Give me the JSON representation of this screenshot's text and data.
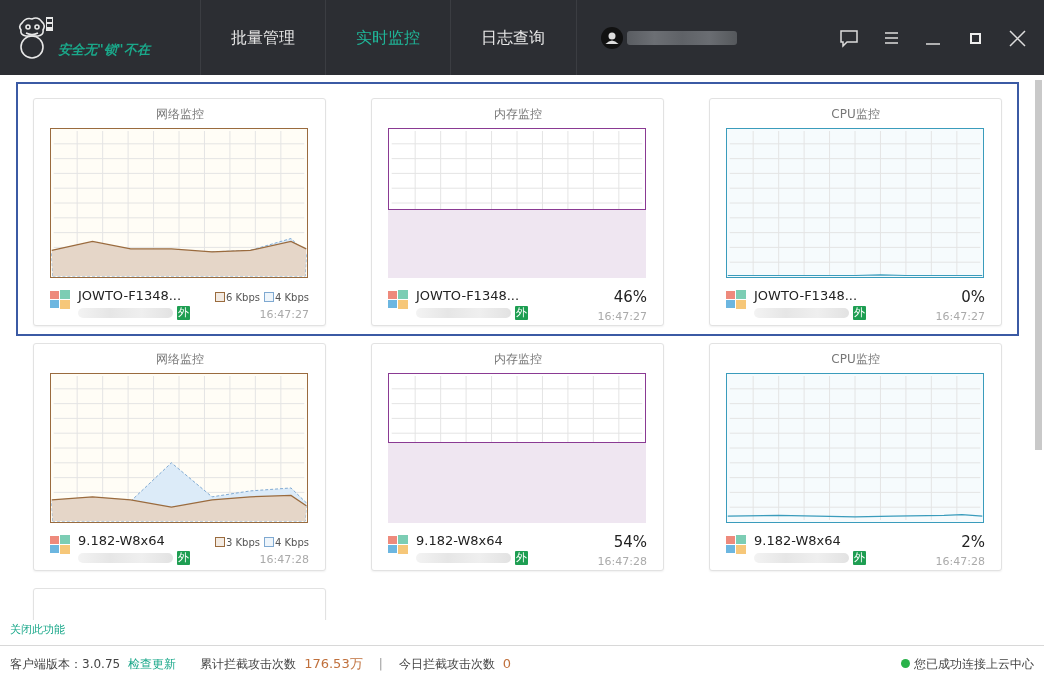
{
  "app": {
    "logo_text": "安全无\"锁\"不在"
  },
  "nav": [
    {
      "label": "批量管理",
      "selected": false
    },
    {
      "label": "实时监控",
      "selected": true
    },
    {
      "label": "日志查询",
      "selected": false
    }
  ],
  "rows": [
    {
      "selected": true,
      "monitors": [
        {
          "kind": "network",
          "title": "网络监控",
          "host": "JOWTO-F1348...",
          "legend": [
            "6 Kbps",
            "4 Kbps"
          ],
          "badge": "外",
          "time": "16:47:27"
        },
        {
          "kind": "memory",
          "title": "内存监控",
          "host": "JOWTO-F1348...",
          "reading": "46%",
          "badge": "外",
          "time": "16:47:27"
        },
        {
          "kind": "cpu",
          "title": "CPU监控",
          "host": "JOWTO-F1348...",
          "reading": "0%",
          "badge": "外",
          "time": "16:47:27"
        }
      ]
    },
    {
      "selected": false,
      "monitors": [
        {
          "kind": "network",
          "title": "网络监控",
          "host": "9.182-W8x64",
          "legend": [
            "3 Kbps",
            "4 Kbps"
          ],
          "badge": "外",
          "time": "16:47:28"
        },
        {
          "kind": "memory",
          "title": "内存监控",
          "host": "9.182-W8x64",
          "reading": "54%",
          "badge": "外",
          "time": "16:47:28"
        },
        {
          "kind": "cpu",
          "title": "CPU监控",
          "host": "9.182-W8x64",
          "reading": "2%",
          "badge": "外",
          "time": "16:47:28"
        }
      ]
    },
    {
      "selected": false,
      "monitors": [
        {
          "kind": "blank"
        }
      ]
    }
  ],
  "close_link": "关闭此功能",
  "status_bar": {
    "version": "客户端版本：3.0.75",
    "update_link": "检查更新",
    "total_label": "累计拦截攻击次数",
    "total_value": "176.53万",
    "separator": "|",
    "today_label": "今日拦截攻击次数",
    "today_value": "0",
    "connection": "您已成功连接上云中心"
  }
}
